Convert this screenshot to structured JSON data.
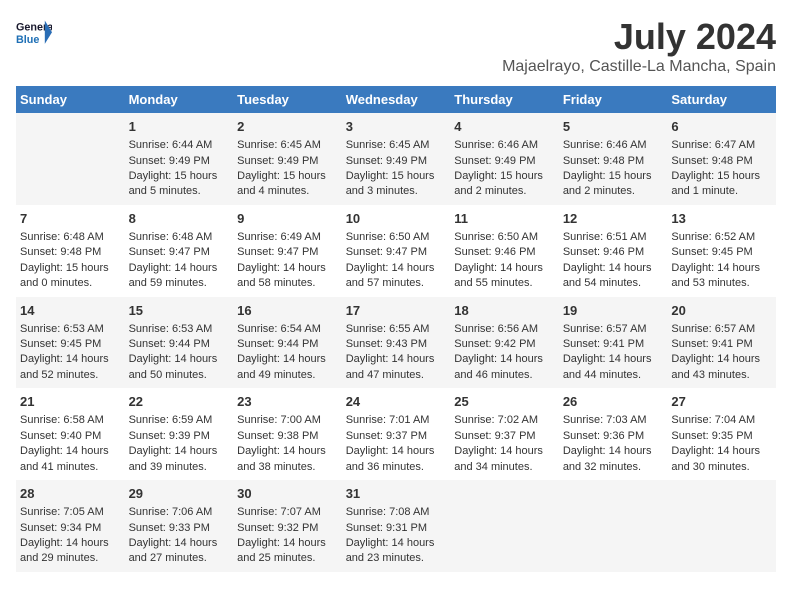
{
  "logo": {
    "line1": "General",
    "line2": "Blue"
  },
  "title": "July 2024",
  "subtitle": "Majaelrayo, Castille-La Mancha, Spain",
  "headers": [
    "Sunday",
    "Monday",
    "Tuesday",
    "Wednesday",
    "Thursday",
    "Friday",
    "Saturday"
  ],
  "weeks": [
    [
      {
        "day": "",
        "lines": []
      },
      {
        "day": "1",
        "lines": [
          "Sunrise: 6:44 AM",
          "Sunset: 9:49 PM",
          "Daylight: 15 hours",
          "and 5 minutes."
        ]
      },
      {
        "day": "2",
        "lines": [
          "Sunrise: 6:45 AM",
          "Sunset: 9:49 PM",
          "Daylight: 15 hours",
          "and 4 minutes."
        ]
      },
      {
        "day": "3",
        "lines": [
          "Sunrise: 6:45 AM",
          "Sunset: 9:49 PM",
          "Daylight: 15 hours",
          "and 3 minutes."
        ]
      },
      {
        "day": "4",
        "lines": [
          "Sunrise: 6:46 AM",
          "Sunset: 9:49 PM",
          "Daylight: 15 hours",
          "and 2 minutes."
        ]
      },
      {
        "day": "5",
        "lines": [
          "Sunrise: 6:46 AM",
          "Sunset: 9:48 PM",
          "Daylight: 15 hours",
          "and 2 minutes."
        ]
      },
      {
        "day": "6",
        "lines": [
          "Sunrise: 6:47 AM",
          "Sunset: 9:48 PM",
          "Daylight: 15 hours",
          "and 1 minute."
        ]
      }
    ],
    [
      {
        "day": "7",
        "lines": [
          "Sunrise: 6:48 AM",
          "Sunset: 9:48 PM",
          "Daylight: 15 hours",
          "and 0 minutes."
        ]
      },
      {
        "day": "8",
        "lines": [
          "Sunrise: 6:48 AM",
          "Sunset: 9:47 PM",
          "Daylight: 14 hours",
          "and 59 minutes."
        ]
      },
      {
        "day": "9",
        "lines": [
          "Sunrise: 6:49 AM",
          "Sunset: 9:47 PM",
          "Daylight: 14 hours",
          "and 58 minutes."
        ]
      },
      {
        "day": "10",
        "lines": [
          "Sunrise: 6:50 AM",
          "Sunset: 9:47 PM",
          "Daylight: 14 hours",
          "and 57 minutes."
        ]
      },
      {
        "day": "11",
        "lines": [
          "Sunrise: 6:50 AM",
          "Sunset: 9:46 PM",
          "Daylight: 14 hours",
          "and 55 minutes."
        ]
      },
      {
        "day": "12",
        "lines": [
          "Sunrise: 6:51 AM",
          "Sunset: 9:46 PM",
          "Daylight: 14 hours",
          "and 54 minutes."
        ]
      },
      {
        "day": "13",
        "lines": [
          "Sunrise: 6:52 AM",
          "Sunset: 9:45 PM",
          "Daylight: 14 hours",
          "and 53 minutes."
        ]
      }
    ],
    [
      {
        "day": "14",
        "lines": [
          "Sunrise: 6:53 AM",
          "Sunset: 9:45 PM",
          "Daylight: 14 hours",
          "and 52 minutes."
        ]
      },
      {
        "day": "15",
        "lines": [
          "Sunrise: 6:53 AM",
          "Sunset: 9:44 PM",
          "Daylight: 14 hours",
          "and 50 minutes."
        ]
      },
      {
        "day": "16",
        "lines": [
          "Sunrise: 6:54 AM",
          "Sunset: 9:44 PM",
          "Daylight: 14 hours",
          "and 49 minutes."
        ]
      },
      {
        "day": "17",
        "lines": [
          "Sunrise: 6:55 AM",
          "Sunset: 9:43 PM",
          "Daylight: 14 hours",
          "and 47 minutes."
        ]
      },
      {
        "day": "18",
        "lines": [
          "Sunrise: 6:56 AM",
          "Sunset: 9:42 PM",
          "Daylight: 14 hours",
          "and 46 minutes."
        ]
      },
      {
        "day": "19",
        "lines": [
          "Sunrise: 6:57 AM",
          "Sunset: 9:41 PM",
          "Daylight: 14 hours",
          "and 44 minutes."
        ]
      },
      {
        "day": "20",
        "lines": [
          "Sunrise: 6:57 AM",
          "Sunset: 9:41 PM",
          "Daylight: 14 hours",
          "and 43 minutes."
        ]
      }
    ],
    [
      {
        "day": "21",
        "lines": [
          "Sunrise: 6:58 AM",
          "Sunset: 9:40 PM",
          "Daylight: 14 hours",
          "and 41 minutes."
        ]
      },
      {
        "day": "22",
        "lines": [
          "Sunrise: 6:59 AM",
          "Sunset: 9:39 PM",
          "Daylight: 14 hours",
          "and 39 minutes."
        ]
      },
      {
        "day": "23",
        "lines": [
          "Sunrise: 7:00 AM",
          "Sunset: 9:38 PM",
          "Daylight: 14 hours",
          "and 38 minutes."
        ]
      },
      {
        "day": "24",
        "lines": [
          "Sunrise: 7:01 AM",
          "Sunset: 9:37 PM",
          "Daylight: 14 hours",
          "and 36 minutes."
        ]
      },
      {
        "day": "25",
        "lines": [
          "Sunrise: 7:02 AM",
          "Sunset: 9:37 PM",
          "Daylight: 14 hours",
          "and 34 minutes."
        ]
      },
      {
        "day": "26",
        "lines": [
          "Sunrise: 7:03 AM",
          "Sunset: 9:36 PM",
          "Daylight: 14 hours",
          "and 32 minutes."
        ]
      },
      {
        "day": "27",
        "lines": [
          "Sunrise: 7:04 AM",
          "Sunset: 9:35 PM",
          "Daylight: 14 hours",
          "and 30 minutes."
        ]
      }
    ],
    [
      {
        "day": "28",
        "lines": [
          "Sunrise: 7:05 AM",
          "Sunset: 9:34 PM",
          "Daylight: 14 hours",
          "and 29 minutes."
        ]
      },
      {
        "day": "29",
        "lines": [
          "Sunrise: 7:06 AM",
          "Sunset: 9:33 PM",
          "Daylight: 14 hours",
          "and 27 minutes."
        ]
      },
      {
        "day": "30",
        "lines": [
          "Sunrise: 7:07 AM",
          "Sunset: 9:32 PM",
          "Daylight: 14 hours",
          "and 25 minutes."
        ]
      },
      {
        "day": "31",
        "lines": [
          "Sunrise: 7:08 AM",
          "Sunset: 9:31 PM",
          "Daylight: 14 hours",
          "and 23 minutes."
        ]
      },
      {
        "day": "",
        "lines": []
      },
      {
        "day": "",
        "lines": []
      },
      {
        "day": "",
        "lines": []
      }
    ]
  ]
}
